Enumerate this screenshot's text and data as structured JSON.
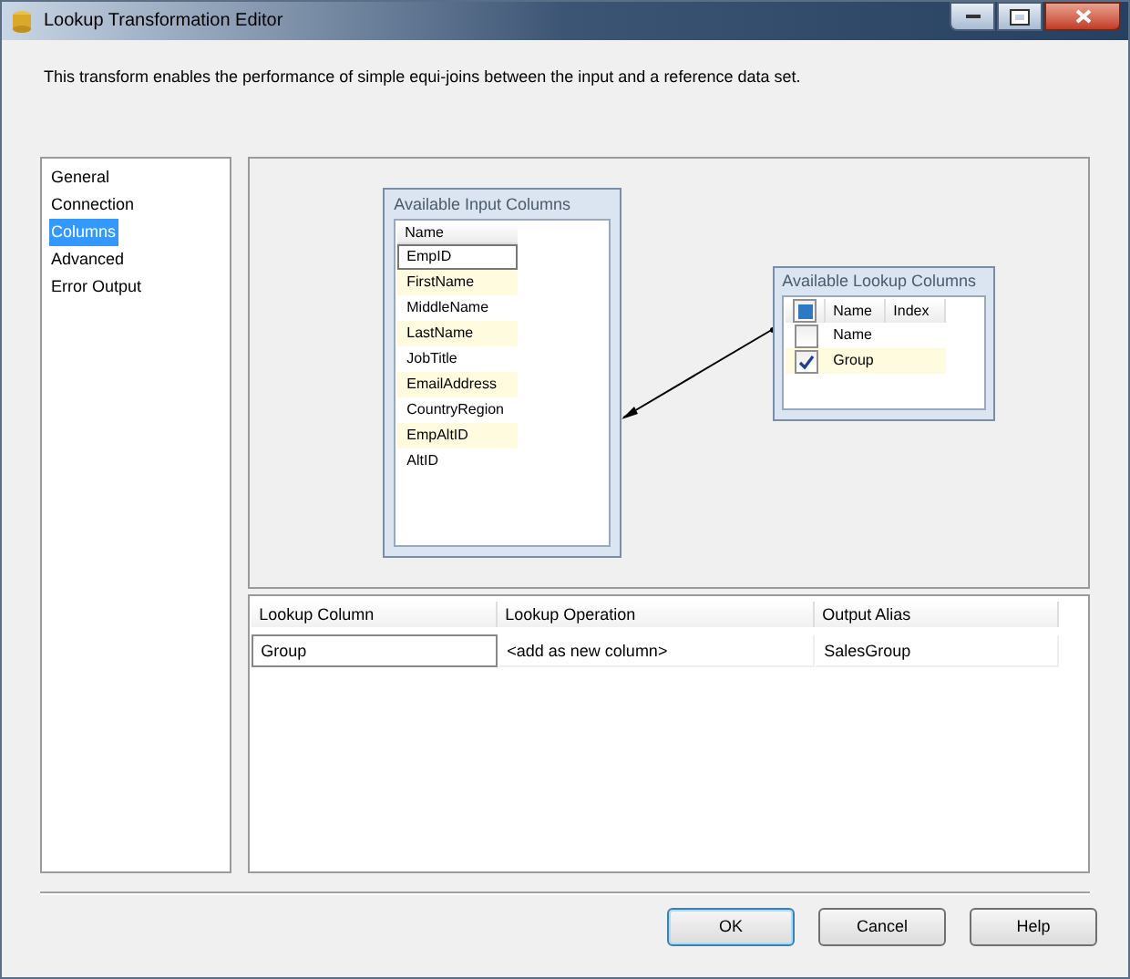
{
  "window": {
    "title": "Lookup Transformation Editor"
  },
  "description": "This transform enables the performance of simple equi-joins between the input and a reference data set.",
  "nav": [
    {
      "label": "General",
      "selected": false
    },
    {
      "label": "Connection",
      "selected": false
    },
    {
      "label": "Columns",
      "selected": true
    },
    {
      "label": "Advanced",
      "selected": false
    },
    {
      "label": "Error Output",
      "selected": false
    }
  ],
  "input_columns": {
    "title": "Available Input Columns",
    "header": "Name",
    "rows": [
      {
        "name": "EmpID",
        "selected": true
      },
      {
        "name": "FirstName",
        "selected": false
      },
      {
        "name": "MiddleName",
        "selected": false
      },
      {
        "name": "LastName",
        "selected": false
      },
      {
        "name": "JobTitle",
        "selected": false
      },
      {
        "name": "EmailAddress",
        "selected": false
      },
      {
        "name": "CountryRegion",
        "selected": false
      },
      {
        "name": "EmpAltID",
        "selected": false
      },
      {
        "name": "AltID",
        "selected": false
      }
    ]
  },
  "lookup_columns": {
    "title": "Available Lookup Columns",
    "select_all_indeterminate": true,
    "headers": [
      "Name",
      "Index"
    ],
    "rows": [
      {
        "name": "Name",
        "checked": false
      },
      {
        "name": "Group",
        "checked": true
      }
    ]
  },
  "mapping_grid": {
    "columns": [
      "Lookup Column",
      "Lookup Operation",
      "Output Alias"
    ],
    "rows": [
      [
        "Group",
        "<add as new column>",
        "SalesGroup"
      ]
    ]
  },
  "buttons": [
    {
      "label": "OK",
      "default": true
    },
    {
      "label": "Cancel",
      "default": false
    },
    {
      "label": "Help",
      "default": false
    }
  ]
}
